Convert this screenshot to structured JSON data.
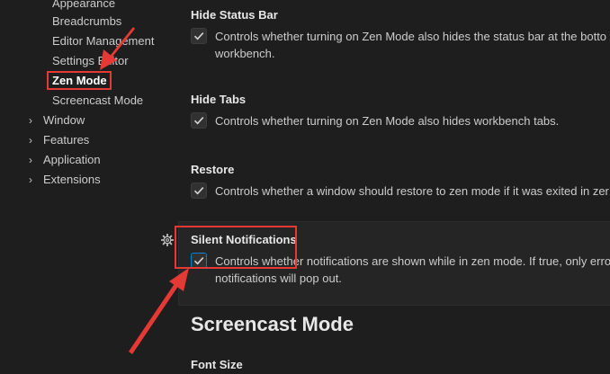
{
  "toc": {
    "children": [
      {
        "label": "Appearance"
      },
      {
        "label": "Breadcrumbs"
      },
      {
        "label": "Editor Management"
      },
      {
        "label": "Settings Editor"
      },
      {
        "label": "Zen Mode"
      },
      {
        "label": "Screencast Mode"
      }
    ],
    "parents": [
      {
        "label": "Window",
        "icon": "chevron-right-icon"
      },
      {
        "label": "Features",
        "icon": "chevron-right-icon"
      },
      {
        "label": "Application",
        "icon": "chevron-right-icon"
      },
      {
        "label": "Extensions",
        "icon": "chevron-right-icon"
      }
    ],
    "selected": "Zen Mode"
  },
  "settings": [
    {
      "title": "Hide Status Bar",
      "checked": true,
      "description_line1": "Controls whether turning on Zen Mode also hides the status bar at the botto",
      "description_line2": "workbench."
    },
    {
      "title": "Hide Tabs",
      "checked": true,
      "description_line1": "Controls whether turning on Zen Mode also hides workbench tabs."
    },
    {
      "title": "Restore",
      "checked": true,
      "description_line1": "Controls whether a window should restore to zen mode if it was exited in zer"
    },
    {
      "title": "Silent Notifications",
      "checked": true,
      "description_line1": "Controls whether notifications are shown while in zen mode. If true, only erro",
      "description_line2": "notifications will pop out."
    }
  ],
  "section_heading": "Screencast Mode",
  "next_setting_title": "Font Size",
  "colors": {
    "background": "#1e1e1e",
    "focused_panel": "#252526",
    "annotation_red": "#e53935",
    "focus_blue": "#007fd4"
  }
}
